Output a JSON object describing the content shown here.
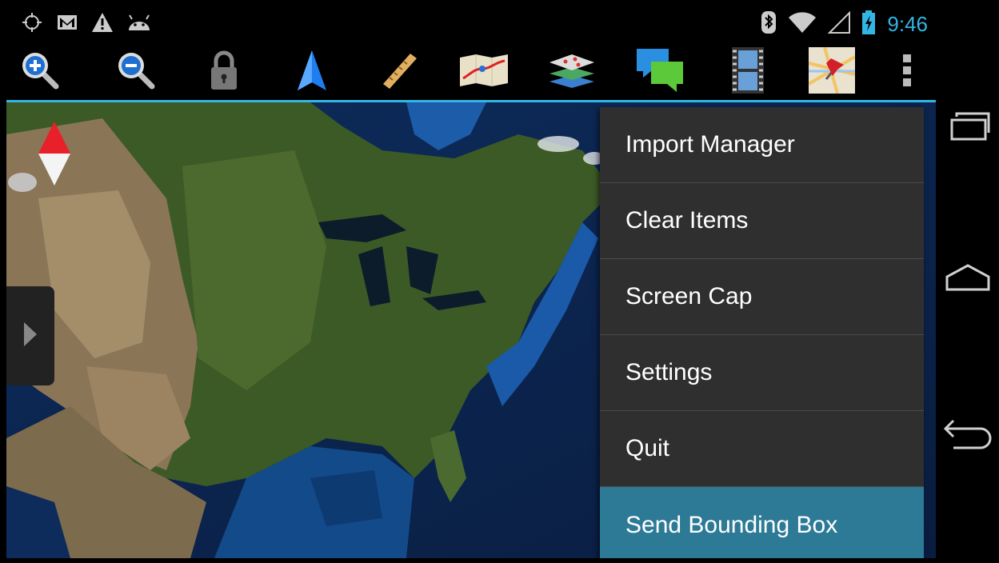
{
  "status_bar": {
    "left_icons": [
      "gps-icon",
      "gmail-icon",
      "warning-icon",
      "android-icon"
    ],
    "right_icons": [
      "bluetooth-icon",
      "wifi-icon",
      "signal-icon",
      "battery-charging-icon"
    ],
    "time": "9:46"
  },
  "toolbar": {
    "buttons": [
      {
        "name": "zoom-in-icon"
      },
      {
        "name": "zoom-out-icon"
      },
      {
        "name": "lock-icon"
      },
      {
        "name": "navigation-arrow-icon"
      },
      {
        "name": "ruler-icon"
      },
      {
        "name": "route-map-icon"
      },
      {
        "name": "layers-icon"
      },
      {
        "name": "chat-icon"
      },
      {
        "name": "film-icon"
      },
      {
        "name": "map-pin-icon"
      },
      {
        "name": "overflow-menu-icon"
      }
    ]
  },
  "menu": {
    "items": [
      {
        "label": "Import Manager"
      },
      {
        "label": "Clear Items"
      },
      {
        "label": "Screen Cap"
      },
      {
        "label": "Settings"
      },
      {
        "label": "Quit"
      },
      {
        "label": "Send Bounding Box",
        "selected": true
      }
    ]
  },
  "nav_bar": {
    "buttons": [
      "recent-apps-icon",
      "home-icon",
      "back-icon"
    ]
  },
  "colors": {
    "accent": "#33b5e5",
    "menu_bg": "#2f2f2f",
    "menu_selected": "#2d7a96"
  }
}
